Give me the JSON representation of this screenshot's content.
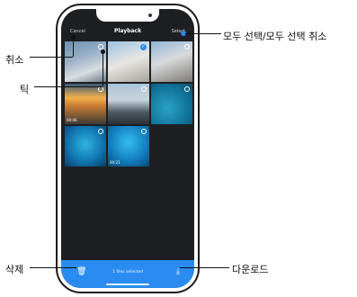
{
  "app": {
    "title": "Playback",
    "cancel_label": "Cancel",
    "select_label": "Select"
  },
  "grid": {
    "items": [
      {
        "duration": "",
        "selected": false
      },
      {
        "duration": "",
        "selected": true
      },
      {
        "duration": "",
        "selected": false
      },
      {
        "duration": "00:06",
        "selected": false
      },
      {
        "duration": "",
        "selected": false
      },
      {
        "duration": "",
        "selected": false
      },
      {
        "duration": "",
        "selected": false
      },
      {
        "duration": "00:21",
        "selected": false
      }
    ]
  },
  "bottom": {
    "status": "1 files selected",
    "delete_icon": "trash-icon",
    "download_icon": "download-icon"
  },
  "callouts": {
    "select_all": "모두 선택/모두 선택 취소",
    "cancel": "취소",
    "tick": "틱",
    "delete": "삭제",
    "download": "다운로드"
  },
  "colors": {
    "accent": "#2a8cf0",
    "screen_bg": "#1e1f22",
    "phone_frame": "#1b1b1b"
  }
}
